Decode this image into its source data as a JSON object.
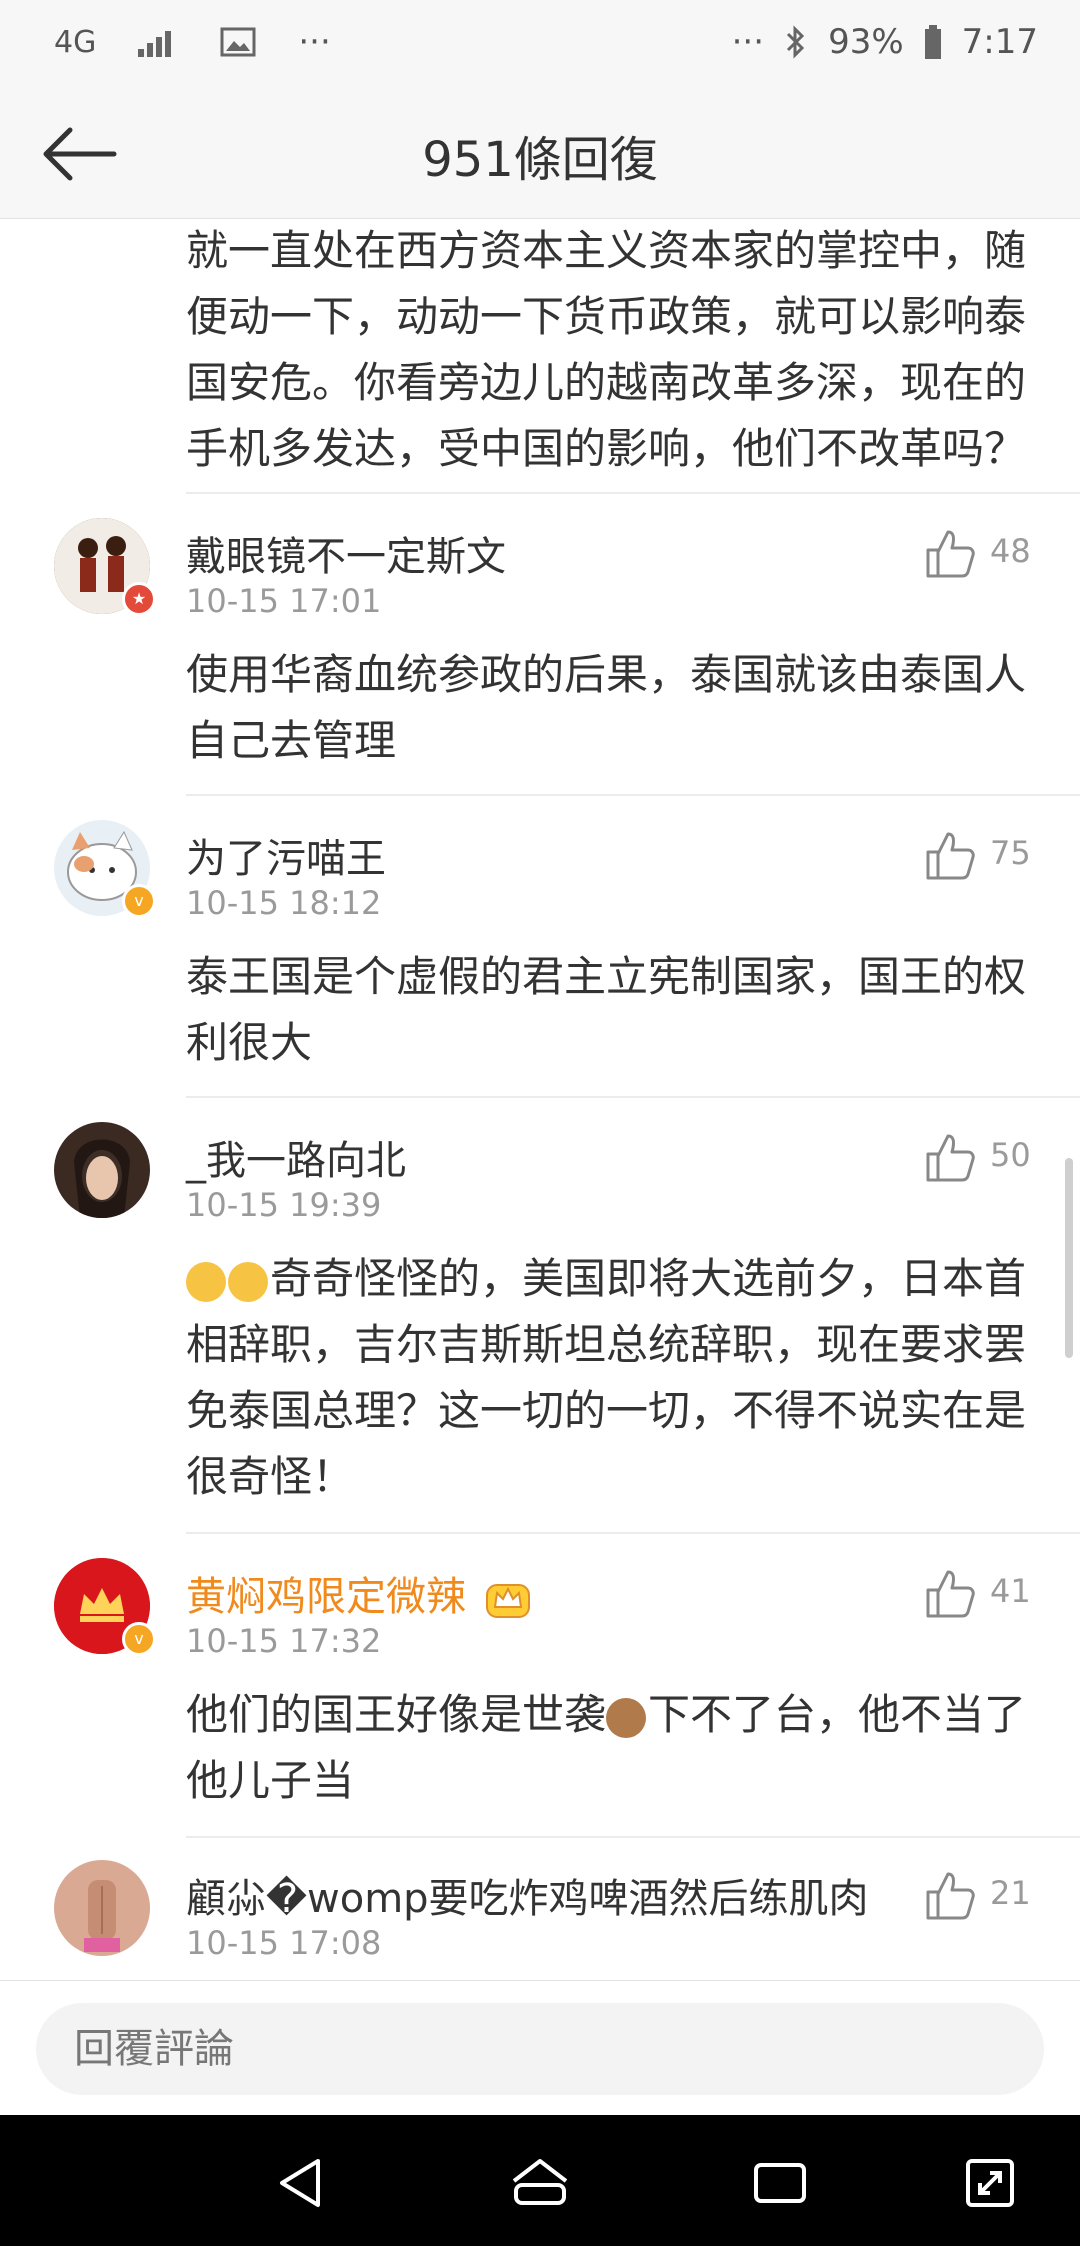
{
  "status_bar": {
    "network": "4G",
    "left_extra": "···",
    "right_extra": "···",
    "battery": "93%",
    "time": "7:17"
  },
  "header": {
    "title": "951條回復"
  },
  "intro_text": "就一直处在西方资本主义资本家的掌控中，随便动一下，动动一下货币政策，就可以影响泰国安危。你看旁边儿的越南改革多深，现在的手机多发达，受中国的影响，他们不改革吗？",
  "comments": [
    {
      "name": "戴眼镜不一定斯文",
      "time": "10-15 17:01",
      "likes": "48",
      "text": "使用华裔血统参政的后果，泰国就该由泰国人自己去管理"
    },
    {
      "name": "为了污喵王",
      "time": "10-15 18:12",
      "likes": "75",
      "text": "泰王国是个虚假的君主立宪制国家，国王的权利很大"
    },
    {
      "name": "_我一路向北",
      "time": "10-15 19:39",
      "likes": "50",
      "text": "奇奇怪怪的，美国即将大选前夕，日本首相辞职，吉尔吉斯斯坦总统辞职，现在要求罢免泰国总理？这一切的一切，不得不说实在是很奇怪！"
    },
    {
      "name": "黄焖鸡限定微辣",
      "time": "10-15 17:32",
      "likes": "41",
      "text_a": "他们的国王好像是世袭",
      "text_b": "下不了台，他不当了他儿子当"
    },
    {
      "name": "顧尛�womp要吃炸鸡啤酒然后练肌肉",
      "time": "10-15 17:08",
      "likes": "21"
    }
  ],
  "reply": {
    "placeholder": "回覆評論"
  },
  "colors": {
    "vip_name": "#f08a1c",
    "verified": "#f5a623",
    "muted": "#9a9a9a"
  }
}
